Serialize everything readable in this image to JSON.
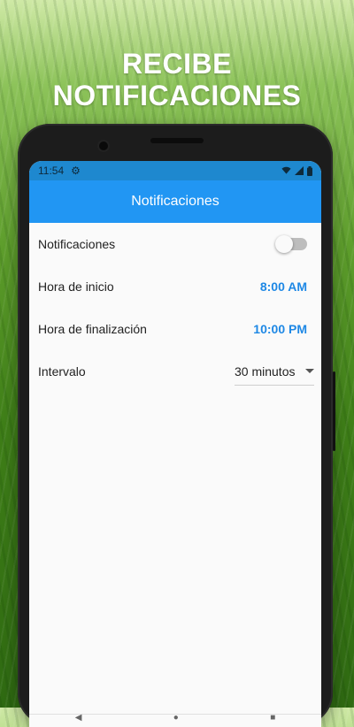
{
  "promo": {
    "line1": "RECIBE",
    "line2": "NOTIFICACIONES"
  },
  "status_bar": {
    "time": "11:54",
    "icons": [
      "settings-gear-icon",
      "wifi-icon",
      "signal-icon",
      "battery-icon"
    ]
  },
  "app_bar": {
    "title": "Notificaciones"
  },
  "settings": {
    "notifications": {
      "label": "Notificaciones",
      "enabled": false
    },
    "start_time": {
      "label": "Hora de inicio",
      "value": "8:00 AM"
    },
    "end_time": {
      "label": "Hora de finalización",
      "value": "10:00 PM"
    },
    "interval": {
      "label": "Intervalo",
      "value": "30 minutos"
    }
  },
  "colors": {
    "app_bar": "#2196f3",
    "status_bar": "#1e88cf",
    "accent_value": "#1e88e5",
    "toggle_track_off": "#bdbdbd"
  }
}
